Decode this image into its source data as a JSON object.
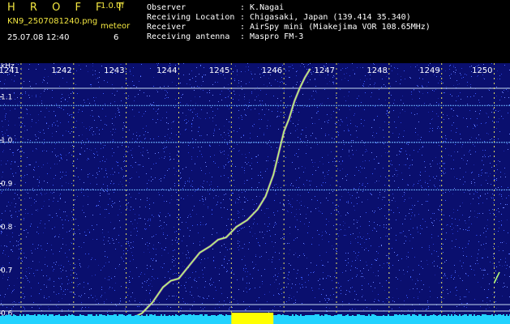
{
  "header": {
    "brand": "H R O F F T",
    "version": "1.0.0f",
    "filename": "KN9_2507081240.png",
    "meteor_label": "meteor",
    "datetime": "25.07.08 12:40",
    "meteor_count": "6",
    "info": [
      {
        "label": "Observer",
        "value": ": K.Nagai"
      },
      {
        "label": "Receiving Location",
        "value": ": Chigasaki, Japan (139.414 35.340)"
      },
      {
        "label": "Receiver",
        "value": ": AirSpy mini (Miakejima VOR 108.65MHz)"
      },
      {
        "label": "Receiving antenna",
        "value": ": Maspro FM-3"
      }
    ]
  },
  "colors": {
    "background": "#0a0f6e",
    "noise": "#3a5cff",
    "trace": "#b6ff7a",
    "header_text_yellow": "#f2e640",
    "header_text_white": "#ffffff",
    "bottom_bar": "#22d3ff",
    "highlight_block": "#ffff00"
  },
  "chart_data": {
    "type": "spectrogram",
    "title": "",
    "xlabel": "",
    "ylabel": "kHz",
    "x_ticks": [
      "1241",
      "1242",
      "1243",
      "1244",
      "1245",
      "1246",
      "1247",
      "1248",
      "1249",
      "1250"
    ],
    "y_ticks": [
      "1.1",
      "1.0",
      "0.9",
      "0.8",
      "0.7",
      "0.6"
    ],
    "xlim": [
      1240.6,
      1250.3
    ],
    "ylim": [
      0.575,
      1.178
    ],
    "reference_lines_khz": [
      1.12,
      1.08,
      0.995,
      0.885,
      0.62,
      0.605
    ],
    "meteor_trace": {
      "x": [
        1243.05,
        1243.3,
        1243.5,
        1243.7,
        1243.85,
        1244.0,
        1244.2,
        1244.4,
        1244.6,
        1244.75,
        1244.9,
        1245.1,
        1245.3,
        1245.5,
        1245.65,
        1245.8,
        1245.9,
        1246.0,
        1246.1,
        1246.2,
        1246.3,
        1246.4,
        1246.5
      ],
      "y": [
        0.585,
        0.6,
        0.625,
        0.66,
        0.675,
        0.68,
        0.71,
        0.74,
        0.755,
        0.77,
        0.775,
        0.8,
        0.815,
        0.84,
        0.87,
        0.92,
        0.97,
        1.02,
        1.05,
        1.09,
        1.12,
        1.145,
        1.165
      ]
    },
    "short_trace": {
      "x": [
        1250.0,
        1250.1
      ],
      "y": [
        0.67,
        0.695
      ]
    }
  }
}
